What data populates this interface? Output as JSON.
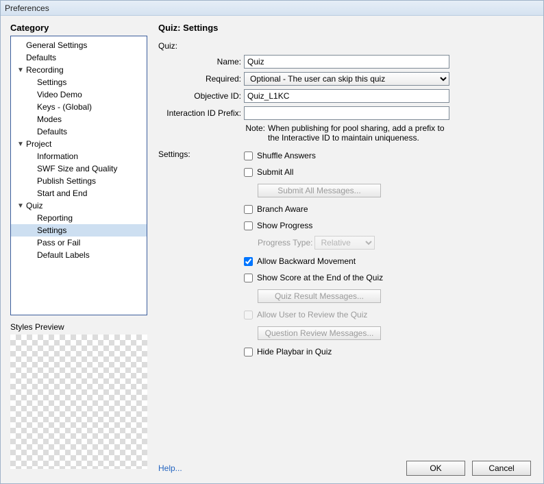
{
  "window": {
    "title": "Preferences"
  },
  "sidebar": {
    "title": "Category",
    "items": [
      {
        "label": "General Settings",
        "level": 0
      },
      {
        "label": "Defaults",
        "level": 0
      },
      {
        "label": "Recording",
        "level": 0,
        "expandable": true
      },
      {
        "label": "Settings",
        "level": 1
      },
      {
        "label": "Video Demo",
        "level": 1
      },
      {
        "label": "Keys - (Global)",
        "level": 1
      },
      {
        "label": "Modes",
        "level": 1
      },
      {
        "label": "Defaults",
        "level": 1
      },
      {
        "label": "Project",
        "level": 0,
        "expandable": true
      },
      {
        "label": "Information",
        "level": 1
      },
      {
        "label": "SWF Size and Quality",
        "level": 1
      },
      {
        "label": "Publish Settings",
        "level": 1
      },
      {
        "label": "Start and End",
        "level": 1
      },
      {
        "label": "Quiz",
        "level": 0,
        "expandable": true
      },
      {
        "label": "Reporting",
        "level": 1
      },
      {
        "label": "Settings",
        "level": 1,
        "selected": true
      },
      {
        "label": "Pass or Fail",
        "level": 1
      },
      {
        "label": "Default Labels",
        "level": 1
      }
    ],
    "styles_preview_label": "Styles Preview"
  },
  "main": {
    "title": "Quiz: Settings",
    "quiz_header": "Quiz:",
    "fields": {
      "name_label": "Name:",
      "name_value": "Quiz",
      "required_label": "Required:",
      "required_value": "Optional - The user can skip this quiz",
      "objective_id_label": "Objective ID:",
      "objective_id_value": "Quiz_L1KC",
      "interaction_prefix_label": "Interaction ID Prefix:",
      "interaction_prefix_value": ""
    },
    "note_label": "Note:",
    "note_text": "When publishing for pool sharing, add a prefix to the Interactive ID to maintain uniqueness.",
    "settings_label": "Settings:",
    "settings": {
      "shuffle_answers": {
        "label": "Shuffle Answers",
        "checked": false
      },
      "submit_all": {
        "label": "Submit All",
        "checked": false
      },
      "submit_all_button": "Submit All Messages...",
      "branch_aware": {
        "label": "Branch Aware",
        "checked": false
      },
      "show_progress": {
        "label": "Show Progress",
        "checked": false
      },
      "progress_type_label": "Progress Type:",
      "progress_type_value": "Relative",
      "allow_backward": {
        "label": "Allow Backward Movement",
        "checked": true
      },
      "show_score": {
        "label": "Show Score at the End of the Quiz",
        "checked": false
      },
      "quiz_result_button": "Quiz Result Messages...",
      "allow_review": {
        "label": "Allow User to Review the Quiz",
        "checked": false
      },
      "question_review_button": "Question Review Messages...",
      "hide_playbar": {
        "label": "Hide Playbar in Quiz",
        "checked": false
      }
    }
  },
  "footer": {
    "help": "Help...",
    "ok": "OK",
    "cancel": "Cancel"
  }
}
